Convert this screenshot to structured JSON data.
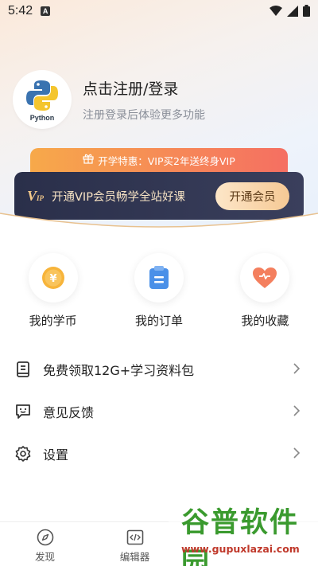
{
  "status_bar": {
    "time": "5:42",
    "notification_letter": "A"
  },
  "profile": {
    "avatar_text": "Python",
    "title": "点击注册/登录",
    "subtitle": "注册登录后体验更多功能"
  },
  "promo": {
    "text": "开学特惠：VIP买2年送终身VIP"
  },
  "vip": {
    "logo": "V",
    "logo_sub": "IP",
    "text": "开通VIP会员畅学全站好课",
    "button": "开通会员"
  },
  "quick_actions": [
    {
      "label": "我的学币",
      "icon": "coin-icon"
    },
    {
      "label": "我的订单",
      "icon": "order-icon"
    },
    {
      "label": "我的收藏",
      "icon": "heart-icon"
    }
  ],
  "menu": [
    {
      "label": "免费领取12G+学习资料包",
      "icon": "book-icon"
    },
    {
      "label": "意见反馈",
      "icon": "feedback-icon"
    },
    {
      "label": "设置",
      "icon": "gear-icon"
    }
  ],
  "tabs": [
    {
      "label": "发现",
      "icon": "compass-icon"
    },
    {
      "label": "编辑器",
      "icon": "code-icon"
    }
  ],
  "watermark": {
    "title": "谷普软件园",
    "url": "www.gupuxlazai.com"
  },
  "colors": {
    "promo_start": "#f7a94a",
    "promo_end": "#f56f62",
    "vip_bg": "#2a2f4a",
    "vip_gold": "#f3c98b"
  }
}
